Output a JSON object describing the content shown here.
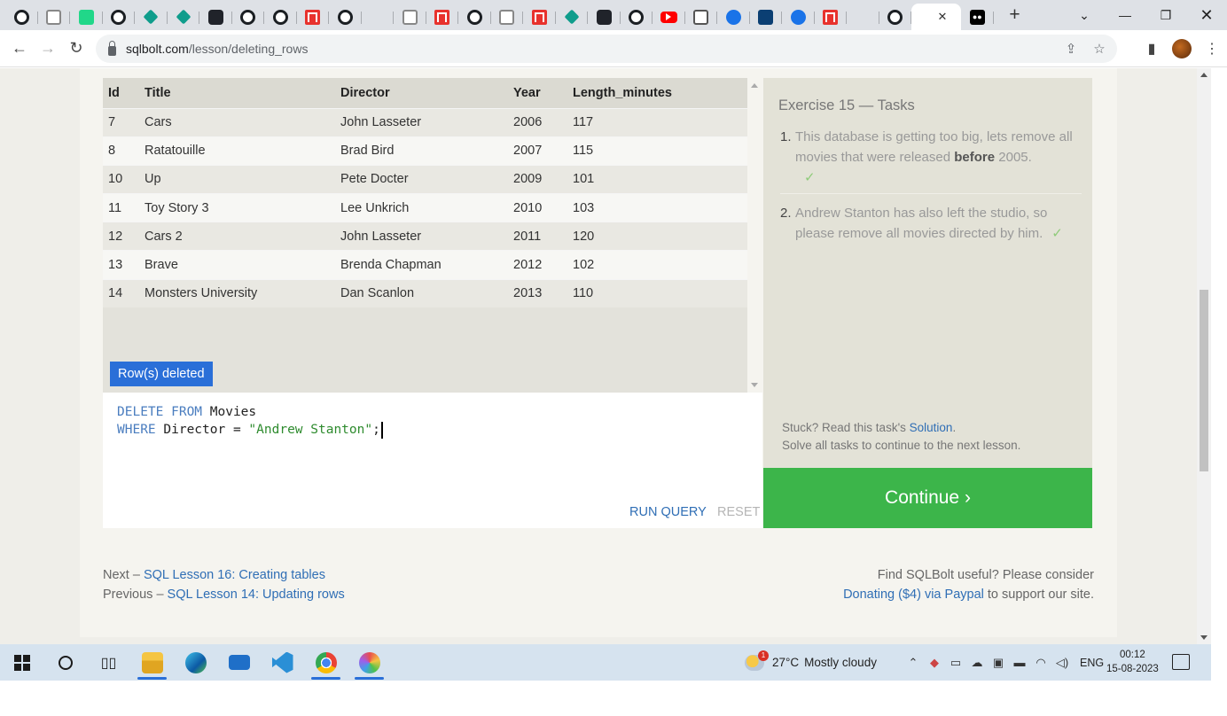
{
  "tabs": [
    {
      "icon": "github-icon"
    },
    {
      "icon": "nyx-icon"
    },
    {
      "icon": "pycharm-icon"
    },
    {
      "icon": "github-icon"
    },
    {
      "icon": "diamond-icon"
    },
    {
      "icon": "diamond-icon"
    },
    {
      "icon": "react-icon"
    },
    {
      "icon": "github-icon"
    },
    {
      "icon": "github-icon"
    },
    {
      "icon": "redbox-icon"
    },
    {
      "icon": "github-icon"
    },
    {
      "icon": "stackoverflow-icon"
    },
    {
      "icon": "nyx-icon"
    },
    {
      "icon": "redbox-icon"
    },
    {
      "icon": "github-icon"
    },
    {
      "icon": "nyx-icon"
    },
    {
      "icon": "redbox-icon"
    },
    {
      "icon": "diamond-icon"
    },
    {
      "icon": "react-icon"
    },
    {
      "icon": "github-icon"
    },
    {
      "icon": "youtube-icon"
    },
    {
      "icon": "square-icon"
    },
    {
      "icon": "zoom-icon"
    },
    {
      "icon": "n-icon"
    },
    {
      "icon": "zoom-icon"
    },
    {
      "icon": "redbox-icon"
    },
    {
      "icon": "stackoverflow-icon"
    },
    {
      "icon": "github-icon"
    }
  ],
  "url": {
    "host": "sqlbolt.com",
    "path": "/lesson/deleting_rows"
  },
  "table": {
    "headers": [
      "Id",
      "Title",
      "Director",
      "Year",
      "Length_minutes"
    ],
    "rows": [
      [
        "7",
        "Cars",
        "John Lasseter",
        "2006",
        "117"
      ],
      [
        "8",
        "Ratatouille",
        "Brad Bird",
        "2007",
        "115"
      ],
      [
        "10",
        "Up",
        "Pete Docter",
        "2009",
        "101"
      ],
      [
        "11",
        "Toy Story 3",
        "Lee Unkrich",
        "2010",
        "103"
      ],
      [
        "12",
        "Cars 2",
        "John Lasseter",
        "2011",
        "120"
      ],
      [
        "13",
        "Brave",
        "Brenda Chapman",
        "2012",
        "102"
      ],
      [
        "14",
        "Monsters University",
        "Dan Scanlon",
        "2013",
        "110"
      ]
    ]
  },
  "status_badge": "Row(s) deleted",
  "editor": {
    "line1_kw": "DELETE FROM",
    "line1_rest": " Movies",
    "line2_kw": "WHERE",
    "line2_mid": " Director = ",
    "line2_str": "\"Andrew Stanton\"",
    "line2_end": ";",
    "run_label": "RUN QUERY",
    "reset_label": "RESET"
  },
  "tasks": {
    "title": "Exercise 15 — Tasks",
    "task1_num": "1.",
    "task1_pre": "This database is getting too big, lets remove all movies that were released ",
    "task1_bold": "before",
    "task1_post": " 2005.",
    "task2_num": "2.",
    "task2": "Andrew Stanton has also left the studio, so please remove all movies directed by him.",
    "check": "✓",
    "stuck_pre": "Stuck? Read this task's ",
    "stuck_link": "Solution",
    "stuck_post": ".",
    "solve_all": "Solve all tasks to continue to the next lesson."
  },
  "continue_label": "Continue ›",
  "footer": {
    "next_pre": "Next – ",
    "next_link": "SQL Lesson 16: Creating tables",
    "prev_pre": "Previous – ",
    "prev_link": "SQL Lesson 14: Updating rows",
    "donate_line1": "Find SQLBolt useful? Please consider",
    "donate_link": "Donating ($4) via Paypal",
    "donate_post": " to support our site."
  },
  "taskbar": {
    "weather_temp": "27°C",
    "weather_text": "Mostly cloudy",
    "weather_badge": "1",
    "lang": "ENG",
    "time": "00:12",
    "date": "15-08-2023"
  },
  "colors": {
    "accent": "#2a6fd8",
    "continue": "#3cb54a",
    "link": "#2f6eb5"
  }
}
